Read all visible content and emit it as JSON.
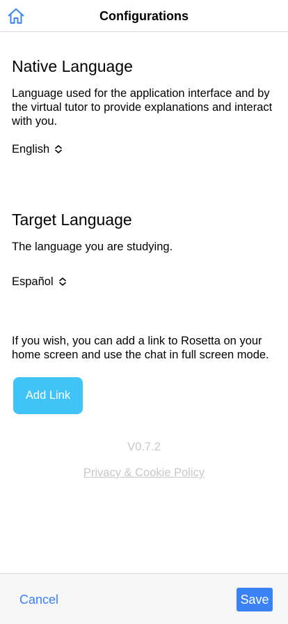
{
  "header": {
    "title": "Configurations",
    "home_icon": "home-icon"
  },
  "native": {
    "title": "Native Language",
    "description": "Language used for the application interface and by the virtual tutor to provide explanations and interact with you.",
    "selected": "English"
  },
  "target": {
    "title": "Target Language",
    "description": "The language you are studying.",
    "selected": "Español"
  },
  "shortcut": {
    "description": "If you wish, you can add a link to Rosetta on your home screen and use the chat in full screen mode.",
    "button_label": "Add Link"
  },
  "version": "V0.7.2",
  "privacy_link": "Privacy & Cookie Policy",
  "footer": {
    "cancel_label": "Cancel",
    "save_label": "Save"
  },
  "colors": {
    "primary": "#3b82f6",
    "accent": "#40c4f8",
    "muted": "#c8c8c8"
  }
}
